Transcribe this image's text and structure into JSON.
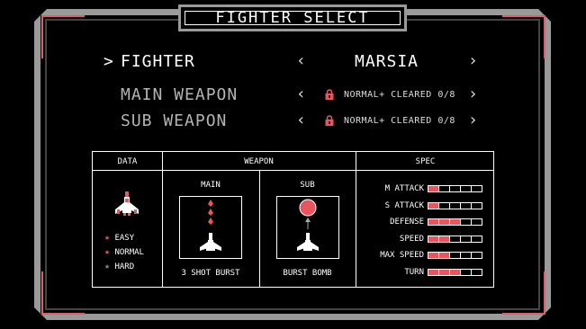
{
  "title": "FIGHTER SELECT",
  "fighter": {
    "label": "FIGHTER",
    "cursor": ">",
    "value": "MARSIA",
    "left": "‹",
    "right": "›"
  },
  "main_weapon": {
    "label": "MAIN WEAPON",
    "status": "NORMAL+ CLEARED 0/8",
    "left": "‹",
    "right": "›"
  },
  "sub_weapon": {
    "label": "SUB WEAPON",
    "status": "NORMAL+ CLEARED 0/8",
    "left": "‹",
    "right": "›"
  },
  "panel": {
    "headers": {
      "data": "DATA",
      "weapon": "WEAPON",
      "spec": "SPEC"
    },
    "main_label": "MAIN",
    "sub_label": "SUB",
    "main_name": "3 SHOT BURST",
    "sub_name": "BURST BOMB",
    "difficulties": [
      {
        "label": "EASY",
        "cleared": true
      },
      {
        "label": "NORMAL",
        "cleared": true
      },
      {
        "label": "HARD",
        "cleared": false
      }
    ],
    "specs": [
      {
        "label": "M ATTACK",
        "level": 1,
        "max": 5
      },
      {
        "label": "S ATTACK",
        "level": 1,
        "max": 5
      },
      {
        "label": "DEFENSE",
        "level": 3,
        "max": 5
      },
      {
        "label": "SPEED",
        "level": 2,
        "max": 5
      },
      {
        "label": "MAX SPEED",
        "level": 2,
        "max": 5
      },
      {
        "label": "TURN",
        "level": 3,
        "max": 5
      }
    ]
  },
  "colors": {
    "accent": "#e8555f",
    "frame": "#9a9a9a",
    "corner": "#d9606a"
  }
}
